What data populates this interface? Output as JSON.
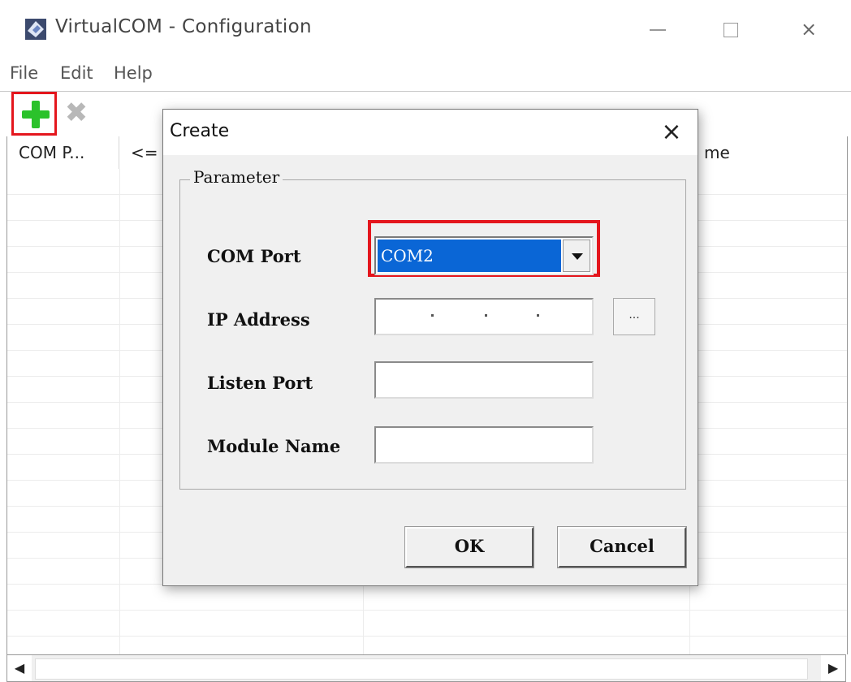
{
  "window": {
    "title": "VirtualCOM - Configuration",
    "controls": {
      "minimize": "minimize",
      "maximize": "maximize",
      "close": "×"
    }
  },
  "menu": {
    "file": "File",
    "edit": "Edit",
    "help": "Help"
  },
  "toolbar": {
    "add_icon": "plus-icon",
    "delete_icon": "x-icon",
    "delete_glyph": "✖",
    "highlight_color": "#e4161d"
  },
  "list": {
    "columns": [
      "COM P...",
      "<=",
      "me"
    ]
  },
  "scrollbar": {
    "left": "◀",
    "right": "▶"
  },
  "dialog": {
    "title": "Create",
    "close": "×",
    "group_title": "Parameter",
    "fields": {
      "com_port_label": "COM Port",
      "com_port_value": "COM2",
      "ip_label": "IP Address",
      "ip_browse": "...",
      "listen_port_label": "Listen Port",
      "module_name_label": "Module Name"
    },
    "ok": "OK",
    "cancel": "Cancel"
  },
  "colors": {
    "selection": "#0a66d6",
    "plus_green": "#2bc22b",
    "highlight_red": "#e4161d"
  }
}
